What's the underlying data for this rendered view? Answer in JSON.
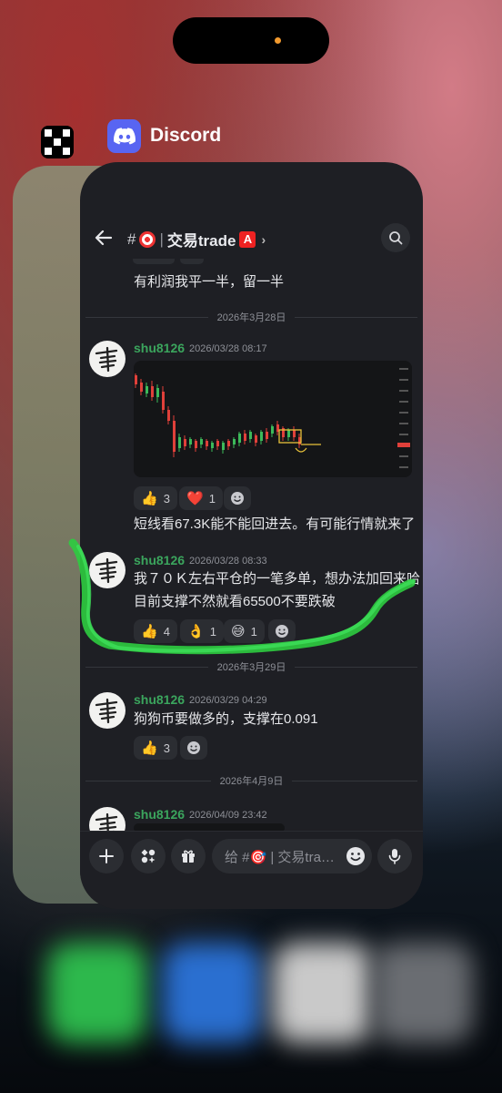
{
  "app_switcher": {
    "app_name": "Discord",
    "accent": "#5865f2"
  },
  "header": {
    "hash": "#",
    "channel_name": "交易trade",
    "badge": "A",
    "chevron": "›"
  },
  "feed": {
    "top_message": "有利润我平一半，留一半",
    "divider_1": "2026年3月28日",
    "msg1": {
      "user": "shu8126",
      "time": "2026/03/28 08:17",
      "reactions": [
        {
          "emoji": "👍",
          "count": "3"
        },
        {
          "emoji": "❤️",
          "count": "1"
        }
      ],
      "text": "短线看67.3K能不能回进去。有可能行情就来了"
    },
    "msg2": {
      "user": "shu8126",
      "time": "2026/03/28 08:33",
      "line1": "我７０Ｋ左右平仓的一笔多单，想办法加回来哈",
      "line2": "目前支撑不然就看65500不要跌破",
      "reactions": [
        {
          "emoji": "👍",
          "count": "4"
        },
        {
          "emoji": "👌",
          "count": "1"
        },
        {
          "emoji": "😅",
          "count": "1"
        }
      ]
    },
    "divider_2": "2026年3月29日",
    "msg3": {
      "user": "shu8126",
      "time": "2026/03/29 04:29",
      "text": "狗狗币要做多的，支撑在0.091",
      "reactions": [
        {
          "emoji": "👍",
          "count": "3"
        }
      ]
    },
    "divider_3": "2026年4月9日",
    "msg4": {
      "user": "shu8126",
      "time": "2026/04/09 23:42"
    }
  },
  "composer": {
    "placeholder": "给 #🎯 | 交易tra…"
  },
  "icons": [
    "back-arrow-icon",
    "search-icon",
    "plus-icon",
    "apps-icon",
    "gift-icon",
    "emoji-icon",
    "microphone-icon",
    "scroll-down-icon"
  ],
  "colors": {
    "username": "#3ba55d",
    "background": "#1e1f24",
    "scribble": "#2ecc40"
  }
}
